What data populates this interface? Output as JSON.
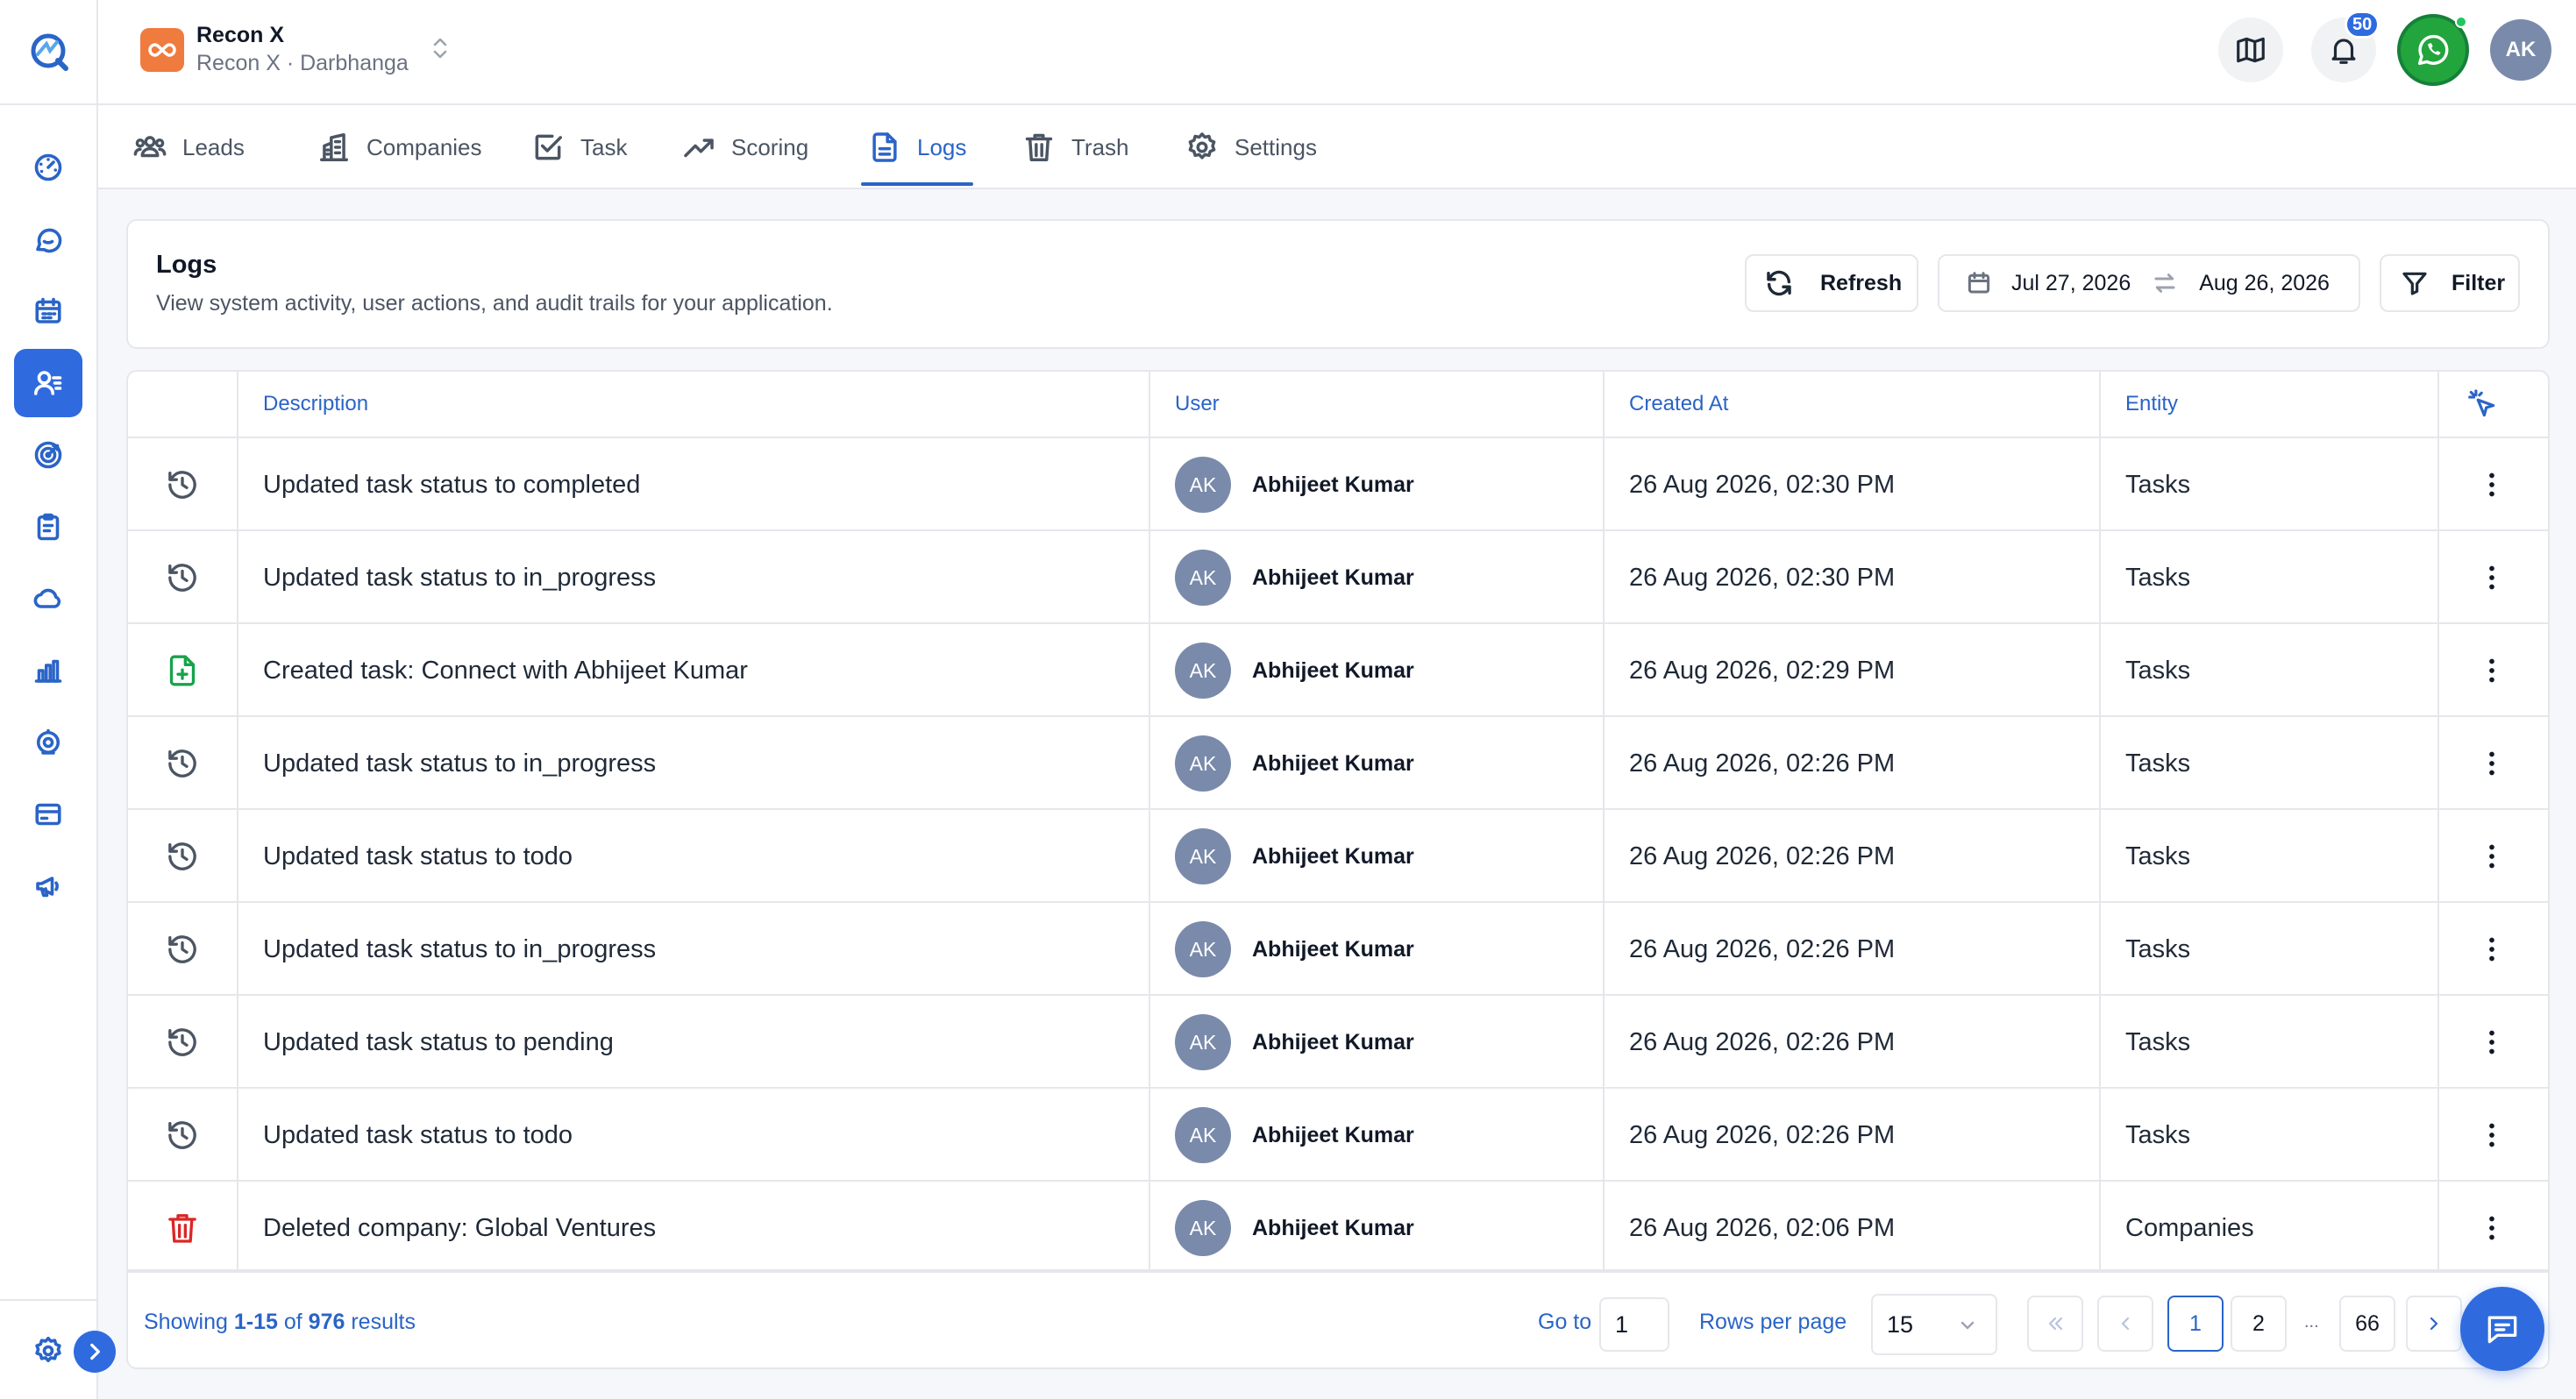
{
  "org": {
    "name": "Recon X",
    "subtitle": "Recon X · Darbhanga"
  },
  "header": {
    "notification_count": "50",
    "user_initials": "AK"
  },
  "sidebar": {
    "items": [
      {
        "name": "dashboard",
        "icon": "gauge-icon"
      },
      {
        "name": "chat",
        "icon": "chat-bubble-icon"
      },
      {
        "name": "calendar",
        "icon": "calendar-icon"
      },
      {
        "name": "crm",
        "icon": "user-list-icon",
        "active": true
      },
      {
        "name": "targets",
        "icon": "target-icon"
      },
      {
        "name": "clipboard",
        "icon": "clipboard-icon"
      },
      {
        "name": "cloud",
        "icon": "cloud-icon"
      },
      {
        "name": "analytics",
        "icon": "bar-chart-icon"
      },
      {
        "name": "camera",
        "icon": "webcam-icon"
      },
      {
        "name": "billing",
        "icon": "card-icon"
      },
      {
        "name": "campaigns",
        "icon": "megaphone-icon"
      }
    ]
  },
  "tabs": [
    {
      "label": "Leads",
      "icon": "users-icon"
    },
    {
      "label": "Companies",
      "icon": "building-icon"
    },
    {
      "label": "Task",
      "icon": "checkbox-icon"
    },
    {
      "label": "Scoring",
      "icon": "trend-icon"
    },
    {
      "label": "Logs",
      "icon": "document-icon",
      "active": true
    },
    {
      "label": "Trash",
      "icon": "trash-icon"
    },
    {
      "label": "Settings",
      "icon": "gear-icon"
    }
  ],
  "page": {
    "title": "Logs",
    "description": "View system activity, user actions, and audit trails for your application.",
    "refresh_label": "Refresh",
    "date_from": "Jul 27, 2026",
    "date_to": "Aug 26, 2026",
    "filter_label": "Filter"
  },
  "table": {
    "columns": {
      "description": "Description",
      "user": "User",
      "created_at": "Created At",
      "entity": "Entity"
    },
    "rows": [
      {
        "type": "history",
        "description": "Updated task status to completed",
        "initials": "AK",
        "user": "Abhijeet Kumar",
        "created_at": "26 Aug 2026, 02:30 PM",
        "entity": "Tasks"
      },
      {
        "type": "history",
        "description": "Updated task status to in_progress",
        "initials": "AK",
        "user": "Abhijeet Kumar",
        "created_at": "26 Aug 2026, 02:30 PM",
        "entity": "Tasks"
      },
      {
        "type": "create",
        "description": "Created task: Connect with Abhijeet Kumar",
        "initials": "AK",
        "user": "Abhijeet Kumar",
        "created_at": "26 Aug 2026, 02:29 PM",
        "entity": "Tasks"
      },
      {
        "type": "history",
        "description": "Updated task status to in_progress",
        "initials": "AK",
        "user": "Abhijeet Kumar",
        "created_at": "26 Aug 2026, 02:26 PM",
        "entity": "Tasks"
      },
      {
        "type": "history",
        "description": "Updated task status to todo",
        "initials": "AK",
        "user": "Abhijeet Kumar",
        "created_at": "26 Aug 2026, 02:26 PM",
        "entity": "Tasks"
      },
      {
        "type": "history",
        "description": "Updated task status to in_progress",
        "initials": "AK",
        "user": "Abhijeet Kumar",
        "created_at": "26 Aug 2026, 02:26 PM",
        "entity": "Tasks"
      },
      {
        "type": "history",
        "description": "Updated task status to pending",
        "initials": "AK",
        "user": "Abhijeet Kumar",
        "created_at": "26 Aug 2026, 02:26 PM",
        "entity": "Tasks"
      },
      {
        "type": "history",
        "description": "Updated task status to todo",
        "initials": "AK",
        "user": "Abhijeet Kumar",
        "created_at": "26 Aug 2026, 02:26 PM",
        "entity": "Tasks"
      },
      {
        "type": "delete",
        "description": "Deleted company: Global Ventures",
        "initials": "AK",
        "user": "Abhijeet Kumar",
        "created_at": "26 Aug 2026, 02:06 PM",
        "entity": "Companies"
      }
    ]
  },
  "pagination": {
    "showing_prefix": "Showing",
    "range": "1-15",
    "of_word": "of",
    "total": "976",
    "results_word": "results",
    "goto_label": "Go to",
    "goto_value": "1",
    "rows_label": "Rows per page",
    "rows_value": "15",
    "pages": [
      "1",
      "2"
    ],
    "ellipsis": "...",
    "last_page": "66"
  },
  "colors": {
    "accent": "#2f6bdf",
    "link": "#2a64c7",
    "create": "#16a34a",
    "delete": "#dc2626",
    "org": "#f07b3f",
    "whatsapp": "#22a53c"
  }
}
